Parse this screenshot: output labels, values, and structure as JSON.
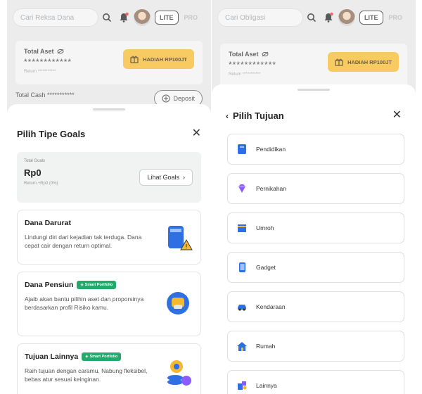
{
  "left": {
    "search_placeholder": "Cari Reksa Dana",
    "lite_label": "LITE",
    "pro_label": "PRO",
    "total_aset_label": "Total Aset",
    "total_aset_value": "************",
    "return_label": "Return",
    "return_value": "***********",
    "hadiah_label": "HADIAH RP100JT",
    "total_cash_label": "Total Cash",
    "total_cash_value": "***********",
    "deposit_label": "Deposit",
    "sheet_title": "Pilih Tipe Goals",
    "total_goals_label": "Total Goals",
    "total_goals_value": "Rp0",
    "total_goals_return": "Return +Rp0 (0%)",
    "lihat_goals_label": "Lihat Goals",
    "goals": [
      {
        "title": "Dana Darurat",
        "badge": "",
        "desc": "Lindungi diri dari kejadian tak terduga. Dana cepat cair dengan return optimal."
      },
      {
        "title": "Dana Pensiun",
        "badge": "Smart Portfolio",
        "desc": "Ajaib akan bantu pilihin aset dan proporsinya berdasarkan profil Risiko kamu."
      },
      {
        "title": "Tujuan Lainnya",
        "badge": "Smart Portfolio",
        "desc": "Raih tujuan dengan caramu. Nabung fleksibel, bebas atur sesuai keinginan."
      }
    ]
  },
  "right": {
    "search_placeholder": "Cari Obligasi",
    "lite_label": "LITE",
    "pro_label": "PRO",
    "total_aset_label": "Total Aset",
    "total_aset_value": "************",
    "return_label": "Return",
    "return_value": "***********",
    "hadiah_label": "HADIAH RP100JT",
    "sheet_title": "Pilih Tujuan",
    "items": [
      {
        "label": "Pendidikan",
        "icon": "book-icon"
      },
      {
        "label": "Pernikahan",
        "icon": "diamond-icon"
      },
      {
        "label": "Umroh",
        "icon": "kaaba-icon"
      },
      {
        "label": "Gadget",
        "icon": "phone-icon"
      },
      {
        "label": "Kendaraan",
        "icon": "car-icon"
      },
      {
        "label": "Rumah",
        "icon": "house-icon"
      },
      {
        "label": "Lainnya",
        "icon": "puzzle-icon"
      }
    ]
  },
  "colors": {
    "accent_yellow": "#f4b92e",
    "badge_green": "#24a86b",
    "icon_blue": "#2f6fe4"
  }
}
